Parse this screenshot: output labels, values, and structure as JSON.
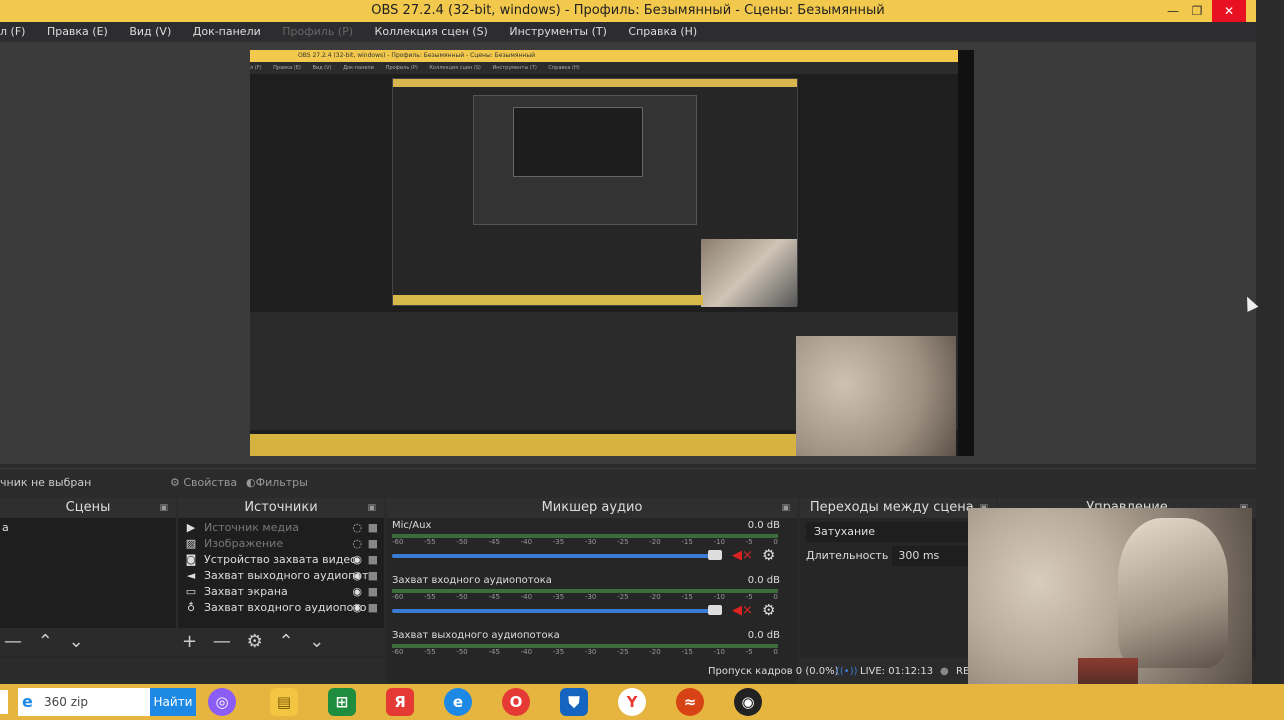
{
  "window": {
    "title": "OBS 27.2.4 (32-bit, windows) - Профиль: Безымянный - Сцены: Безымянный"
  },
  "menu": [
    "л (F)",
    "Правка (E)",
    "Вид (V)",
    "Док-панели",
    "Профиль (P)",
    "Коллекция сцен (S)",
    "Инструменты (T)",
    "Справка (H)"
  ],
  "mini_title": "OBS 27.2.4 (32-bit, windows) - Профиль: Безымянный - Сцены: Безымянный",
  "mini_menu": [
    "л (F)",
    "Правка (E)",
    "Вид (V)",
    "Док-панели",
    "Профиль (P)",
    "Коллекция сцен (S)",
    "Инструменты (T)",
    "Справка (H)"
  ],
  "source_bar": {
    "label": "чник не выбран",
    "properties": "Свойства",
    "filters": "Фильтры"
  },
  "scenes": {
    "title": "Сцены",
    "items": [
      "а"
    ]
  },
  "sources": {
    "title": "Источники",
    "items": [
      {
        "label": "Источник медиа",
        "icon": "play-icon",
        "hidden": true
      },
      {
        "label": "Изображение",
        "icon": "image-icon",
        "hidden": true
      },
      {
        "label": "Устройство захвата видео",
        "icon": "camera-icon",
        "hidden": false
      },
      {
        "label": "Захват выходного аудиопот",
        "icon": "speaker-icon",
        "hidden": false
      },
      {
        "label": "Захват экрана",
        "icon": "monitor-icon",
        "hidden": false
      },
      {
        "label": "Захват входного аудиопото",
        "icon": "mic-icon",
        "hidden": false
      }
    ]
  },
  "mixer": {
    "title": "Микшер аудио",
    "scale": [
      "-60",
      "-55",
      "-50",
      "-45",
      "-40",
      "-35",
      "-30",
      "-25",
      "-20",
      "-15",
      "-10",
      "-5",
      "0"
    ],
    "channels": [
      {
        "name": "Mic/Aux",
        "db": "0.0 dB"
      },
      {
        "name": "Захват входного аудиопотока",
        "db": "0.0 dB"
      },
      {
        "name": "Захват выходного аудиопотока",
        "db": "0.0 dB"
      }
    ]
  },
  "transitions": {
    "title": "Переходы между сцена...",
    "selected": "Затухание",
    "duration_label": "Длительность",
    "duration_value": "300 ms"
  },
  "controls": {
    "title": "Управление"
  },
  "status": {
    "dropped": "Пропуск кадров 0 (0.0%)",
    "live": "LIVE: 01:12:13",
    "rec": "RE"
  },
  "taskbar": {
    "search_value": "360 zip",
    "find_label": "Найти",
    "apps": [
      "alice",
      "explorer",
      "excel",
      "yandex-ya",
      "edge",
      "opera",
      "shield",
      "yandex-browser",
      "wave",
      "obs"
    ]
  }
}
